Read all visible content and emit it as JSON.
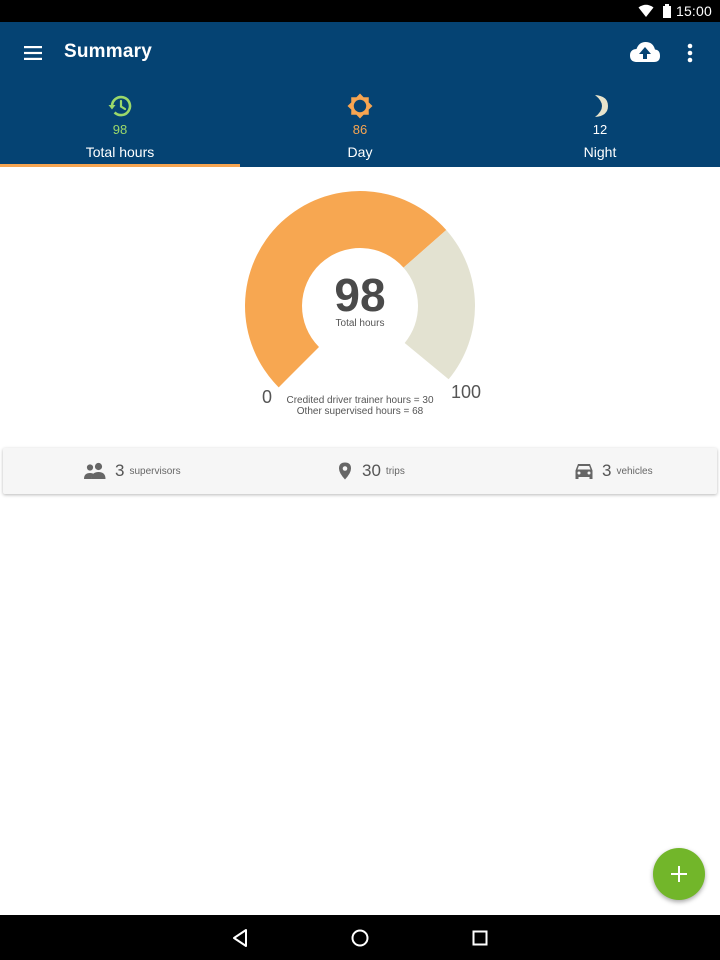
{
  "status_bar": {
    "time": "15:00",
    "icons": [
      "wifi-icon",
      "battery-icon"
    ]
  },
  "app_bar": {
    "title": "Summary",
    "icons": [
      "menu-icon",
      "cloud-upload-icon",
      "more-vert-icon"
    ]
  },
  "tabs": [
    {
      "label": "Total hours",
      "value": "98",
      "icon": "history-clock-icon",
      "color": "#9BD86A",
      "active": true
    },
    {
      "label": "Day",
      "value": "86",
      "icon": "sun-icon",
      "color": "#F7A551",
      "active": false
    },
    {
      "label": "Night",
      "value": "12",
      "icon": "moon-icon",
      "color": "#E8E4CC",
      "active": false
    }
  ],
  "gauge": {
    "value": "98",
    "caption": "Total hours",
    "min_label": "0",
    "max_label": "100",
    "fill_fraction": 0.98,
    "credited_fraction": 0.3,
    "colors": {
      "main": "#F7A751",
      "credited": "#E3E2D1"
    },
    "notes": [
      "Credited driver trainer hours = 30",
      "Other supervised hours = 68"
    ]
  },
  "stats": [
    {
      "icon": "people-icon",
      "value": "3",
      "label": "supervisors"
    },
    {
      "icon": "location-pin-icon",
      "value": "30",
      "label": "trips"
    },
    {
      "icon": "car-icon",
      "value": "3",
      "label": "vehicles"
    }
  ],
  "fab": {
    "icon": "plus-icon",
    "color": "#72B62A"
  },
  "nav_bar": {
    "buttons": [
      "back-icon",
      "home-icon",
      "recents-icon"
    ]
  },
  "colors": {
    "primary": "#054373",
    "accent": "#F7A551",
    "fab": "#72B62A"
  }
}
